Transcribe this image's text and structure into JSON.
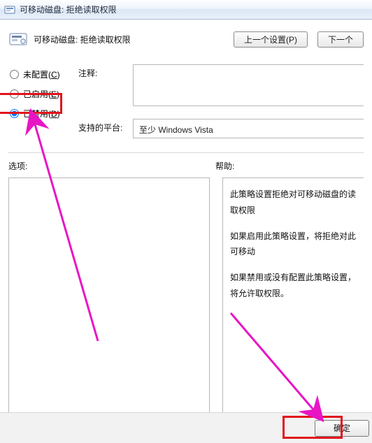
{
  "window": {
    "title": "可移动磁盘: 拒绝读取权限"
  },
  "header": {
    "title": "可移动磁盘: 拒绝读取权限",
    "prev": "上一个设置(P)",
    "next": "下一个"
  },
  "radios": {
    "not_configured": "未配置(C)",
    "not_configured_key": "C",
    "enabled": "已启用(E)",
    "enabled_key": "E",
    "disabled": "已禁用(D)",
    "disabled_key": "D",
    "selected": "disabled"
  },
  "fields": {
    "comment_label": "注释:",
    "platform_label": "支持的平台:",
    "platform_value": "至少 Windows Vista"
  },
  "sections": {
    "options": "选项:",
    "help": "帮助:"
  },
  "help": {
    "p1": "此策略设置拒绝对可移动磁盘的读取权限",
    "p2": "如果启用此策略设置，将拒绝对此可移动",
    "p3a": "如果禁用或没有配置此策略设置，将允许",
    "p3b": "取权限。"
  },
  "buttons": {
    "ok": "确定"
  },
  "colors": {
    "highlight": "#e3141b",
    "arrow": "#e815c5"
  }
}
